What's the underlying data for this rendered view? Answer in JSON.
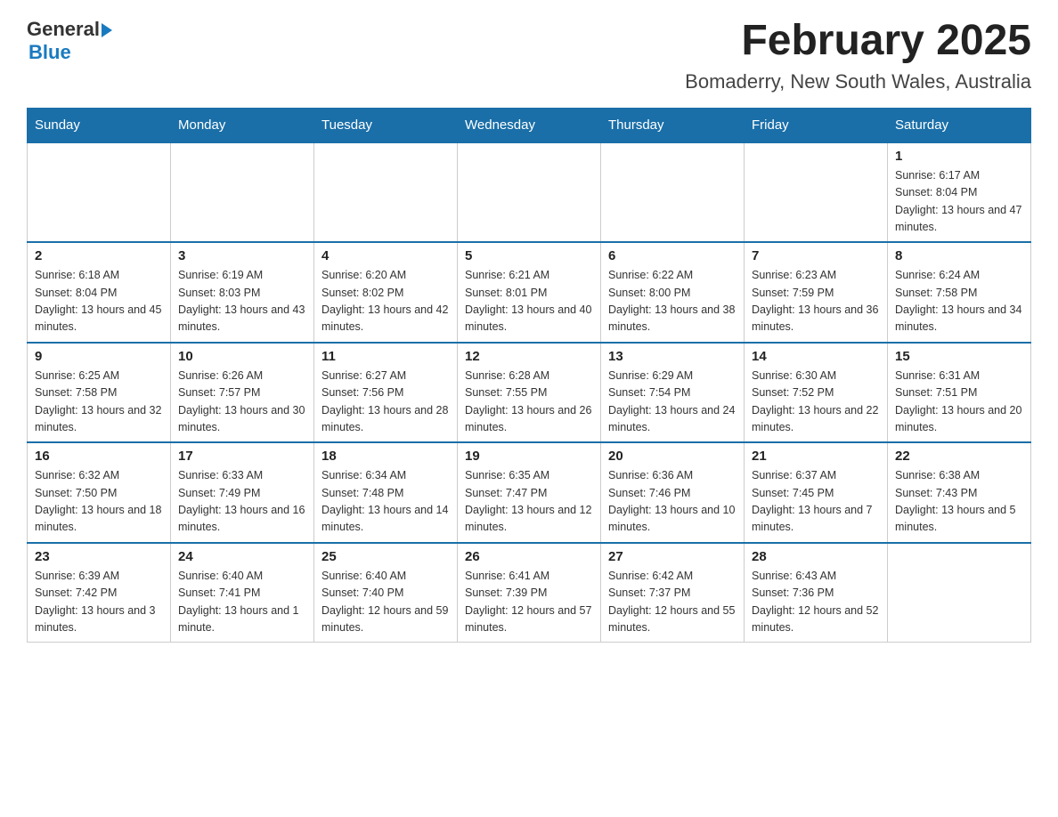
{
  "header": {
    "month_title": "February 2025",
    "location": "Bomaderry, New South Wales, Australia",
    "logo_general": "General",
    "logo_blue": "Blue"
  },
  "days_of_week": [
    "Sunday",
    "Monday",
    "Tuesday",
    "Wednesday",
    "Thursday",
    "Friday",
    "Saturday"
  ],
  "weeks": [
    [
      {
        "day": "",
        "info": ""
      },
      {
        "day": "",
        "info": ""
      },
      {
        "day": "",
        "info": ""
      },
      {
        "day": "",
        "info": ""
      },
      {
        "day": "",
        "info": ""
      },
      {
        "day": "",
        "info": ""
      },
      {
        "day": "1",
        "info": "Sunrise: 6:17 AM\nSunset: 8:04 PM\nDaylight: 13 hours and 47 minutes."
      }
    ],
    [
      {
        "day": "2",
        "info": "Sunrise: 6:18 AM\nSunset: 8:04 PM\nDaylight: 13 hours and 45 minutes."
      },
      {
        "day": "3",
        "info": "Sunrise: 6:19 AM\nSunset: 8:03 PM\nDaylight: 13 hours and 43 minutes."
      },
      {
        "day": "4",
        "info": "Sunrise: 6:20 AM\nSunset: 8:02 PM\nDaylight: 13 hours and 42 minutes."
      },
      {
        "day": "5",
        "info": "Sunrise: 6:21 AM\nSunset: 8:01 PM\nDaylight: 13 hours and 40 minutes."
      },
      {
        "day": "6",
        "info": "Sunrise: 6:22 AM\nSunset: 8:00 PM\nDaylight: 13 hours and 38 minutes."
      },
      {
        "day": "7",
        "info": "Sunrise: 6:23 AM\nSunset: 7:59 PM\nDaylight: 13 hours and 36 minutes."
      },
      {
        "day": "8",
        "info": "Sunrise: 6:24 AM\nSunset: 7:58 PM\nDaylight: 13 hours and 34 minutes."
      }
    ],
    [
      {
        "day": "9",
        "info": "Sunrise: 6:25 AM\nSunset: 7:58 PM\nDaylight: 13 hours and 32 minutes."
      },
      {
        "day": "10",
        "info": "Sunrise: 6:26 AM\nSunset: 7:57 PM\nDaylight: 13 hours and 30 minutes."
      },
      {
        "day": "11",
        "info": "Sunrise: 6:27 AM\nSunset: 7:56 PM\nDaylight: 13 hours and 28 minutes."
      },
      {
        "day": "12",
        "info": "Sunrise: 6:28 AM\nSunset: 7:55 PM\nDaylight: 13 hours and 26 minutes."
      },
      {
        "day": "13",
        "info": "Sunrise: 6:29 AM\nSunset: 7:54 PM\nDaylight: 13 hours and 24 minutes."
      },
      {
        "day": "14",
        "info": "Sunrise: 6:30 AM\nSunset: 7:52 PM\nDaylight: 13 hours and 22 minutes."
      },
      {
        "day": "15",
        "info": "Sunrise: 6:31 AM\nSunset: 7:51 PM\nDaylight: 13 hours and 20 minutes."
      }
    ],
    [
      {
        "day": "16",
        "info": "Sunrise: 6:32 AM\nSunset: 7:50 PM\nDaylight: 13 hours and 18 minutes."
      },
      {
        "day": "17",
        "info": "Sunrise: 6:33 AM\nSunset: 7:49 PM\nDaylight: 13 hours and 16 minutes."
      },
      {
        "day": "18",
        "info": "Sunrise: 6:34 AM\nSunset: 7:48 PM\nDaylight: 13 hours and 14 minutes."
      },
      {
        "day": "19",
        "info": "Sunrise: 6:35 AM\nSunset: 7:47 PM\nDaylight: 13 hours and 12 minutes."
      },
      {
        "day": "20",
        "info": "Sunrise: 6:36 AM\nSunset: 7:46 PM\nDaylight: 13 hours and 10 minutes."
      },
      {
        "day": "21",
        "info": "Sunrise: 6:37 AM\nSunset: 7:45 PM\nDaylight: 13 hours and 7 minutes."
      },
      {
        "day": "22",
        "info": "Sunrise: 6:38 AM\nSunset: 7:43 PM\nDaylight: 13 hours and 5 minutes."
      }
    ],
    [
      {
        "day": "23",
        "info": "Sunrise: 6:39 AM\nSunset: 7:42 PM\nDaylight: 13 hours and 3 minutes."
      },
      {
        "day": "24",
        "info": "Sunrise: 6:40 AM\nSunset: 7:41 PM\nDaylight: 13 hours and 1 minute."
      },
      {
        "day": "25",
        "info": "Sunrise: 6:40 AM\nSunset: 7:40 PM\nDaylight: 12 hours and 59 minutes."
      },
      {
        "day": "26",
        "info": "Sunrise: 6:41 AM\nSunset: 7:39 PM\nDaylight: 12 hours and 57 minutes."
      },
      {
        "day": "27",
        "info": "Sunrise: 6:42 AM\nSunset: 7:37 PM\nDaylight: 12 hours and 55 minutes."
      },
      {
        "day": "28",
        "info": "Sunrise: 6:43 AM\nSunset: 7:36 PM\nDaylight: 12 hours and 52 minutes."
      },
      {
        "day": "",
        "info": ""
      }
    ]
  ]
}
